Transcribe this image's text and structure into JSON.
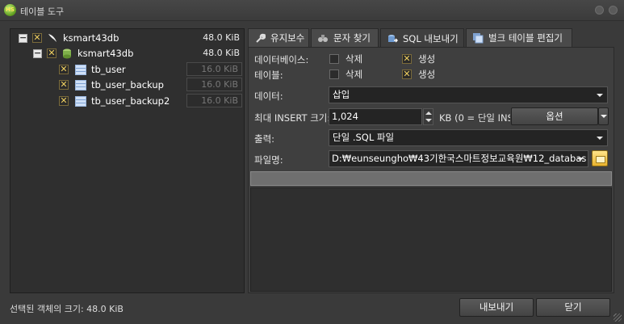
{
  "window": {
    "title": "테이블 도구",
    "app_icon": "HS"
  },
  "tree": {
    "root": {
      "label": "ksmart43db",
      "size": "48.0 KiB",
      "checked": true
    },
    "db": {
      "label": "ksmart43db",
      "size": "48.0 KiB",
      "checked": true
    },
    "tables": [
      {
        "label": "tb_user",
        "size": "16.0 KiB",
        "checked": true
      },
      {
        "label": "tb_user_backup",
        "size": "16.0 KiB",
        "checked": true
      },
      {
        "label": "tb_user_backup2",
        "size": "16.0 KiB",
        "checked": true
      }
    ]
  },
  "tabs": [
    {
      "label": "유지보수",
      "icon": "wrench-icon",
      "active": false
    },
    {
      "label": "문자 찾기",
      "icon": "binoculars-icon",
      "active": false
    },
    {
      "label": "SQL 내보내기",
      "icon": "sql-export-icon",
      "active": true
    },
    {
      "label": "벌크 테이블 편집기",
      "icon": "bulk-table-icon",
      "active": false
    }
  ],
  "form": {
    "database": {
      "label": "데이터베이스:",
      "drop": {
        "label": "삭제",
        "checked": false
      },
      "create": {
        "label": "생성",
        "checked": true
      }
    },
    "table": {
      "label": "테이블:",
      "drop": {
        "label": "삭제",
        "checked": false
      },
      "create": {
        "label": "생성",
        "checked": true
      }
    },
    "data": {
      "label": "데이터:",
      "value": "삽입"
    },
    "max_insert": {
      "label": "최대 INSERT 크기:",
      "value": "1,024",
      "unit_text": "KB (0 = 단일 INS",
      "options_button": "옵션"
    },
    "output": {
      "label": "출력:",
      "value": "단일 .SQL 파일"
    },
    "filename": {
      "label": "파일명:",
      "value": "D:₩eunseungho₩43기한국스마트정보교육원₩12_databas"
    }
  },
  "progress": {
    "value": 0
  },
  "status": {
    "text": "선택된 객체의 크기: 48.0 KiB"
  },
  "buttons": {
    "export": "내보내기",
    "close": "닫기"
  }
}
